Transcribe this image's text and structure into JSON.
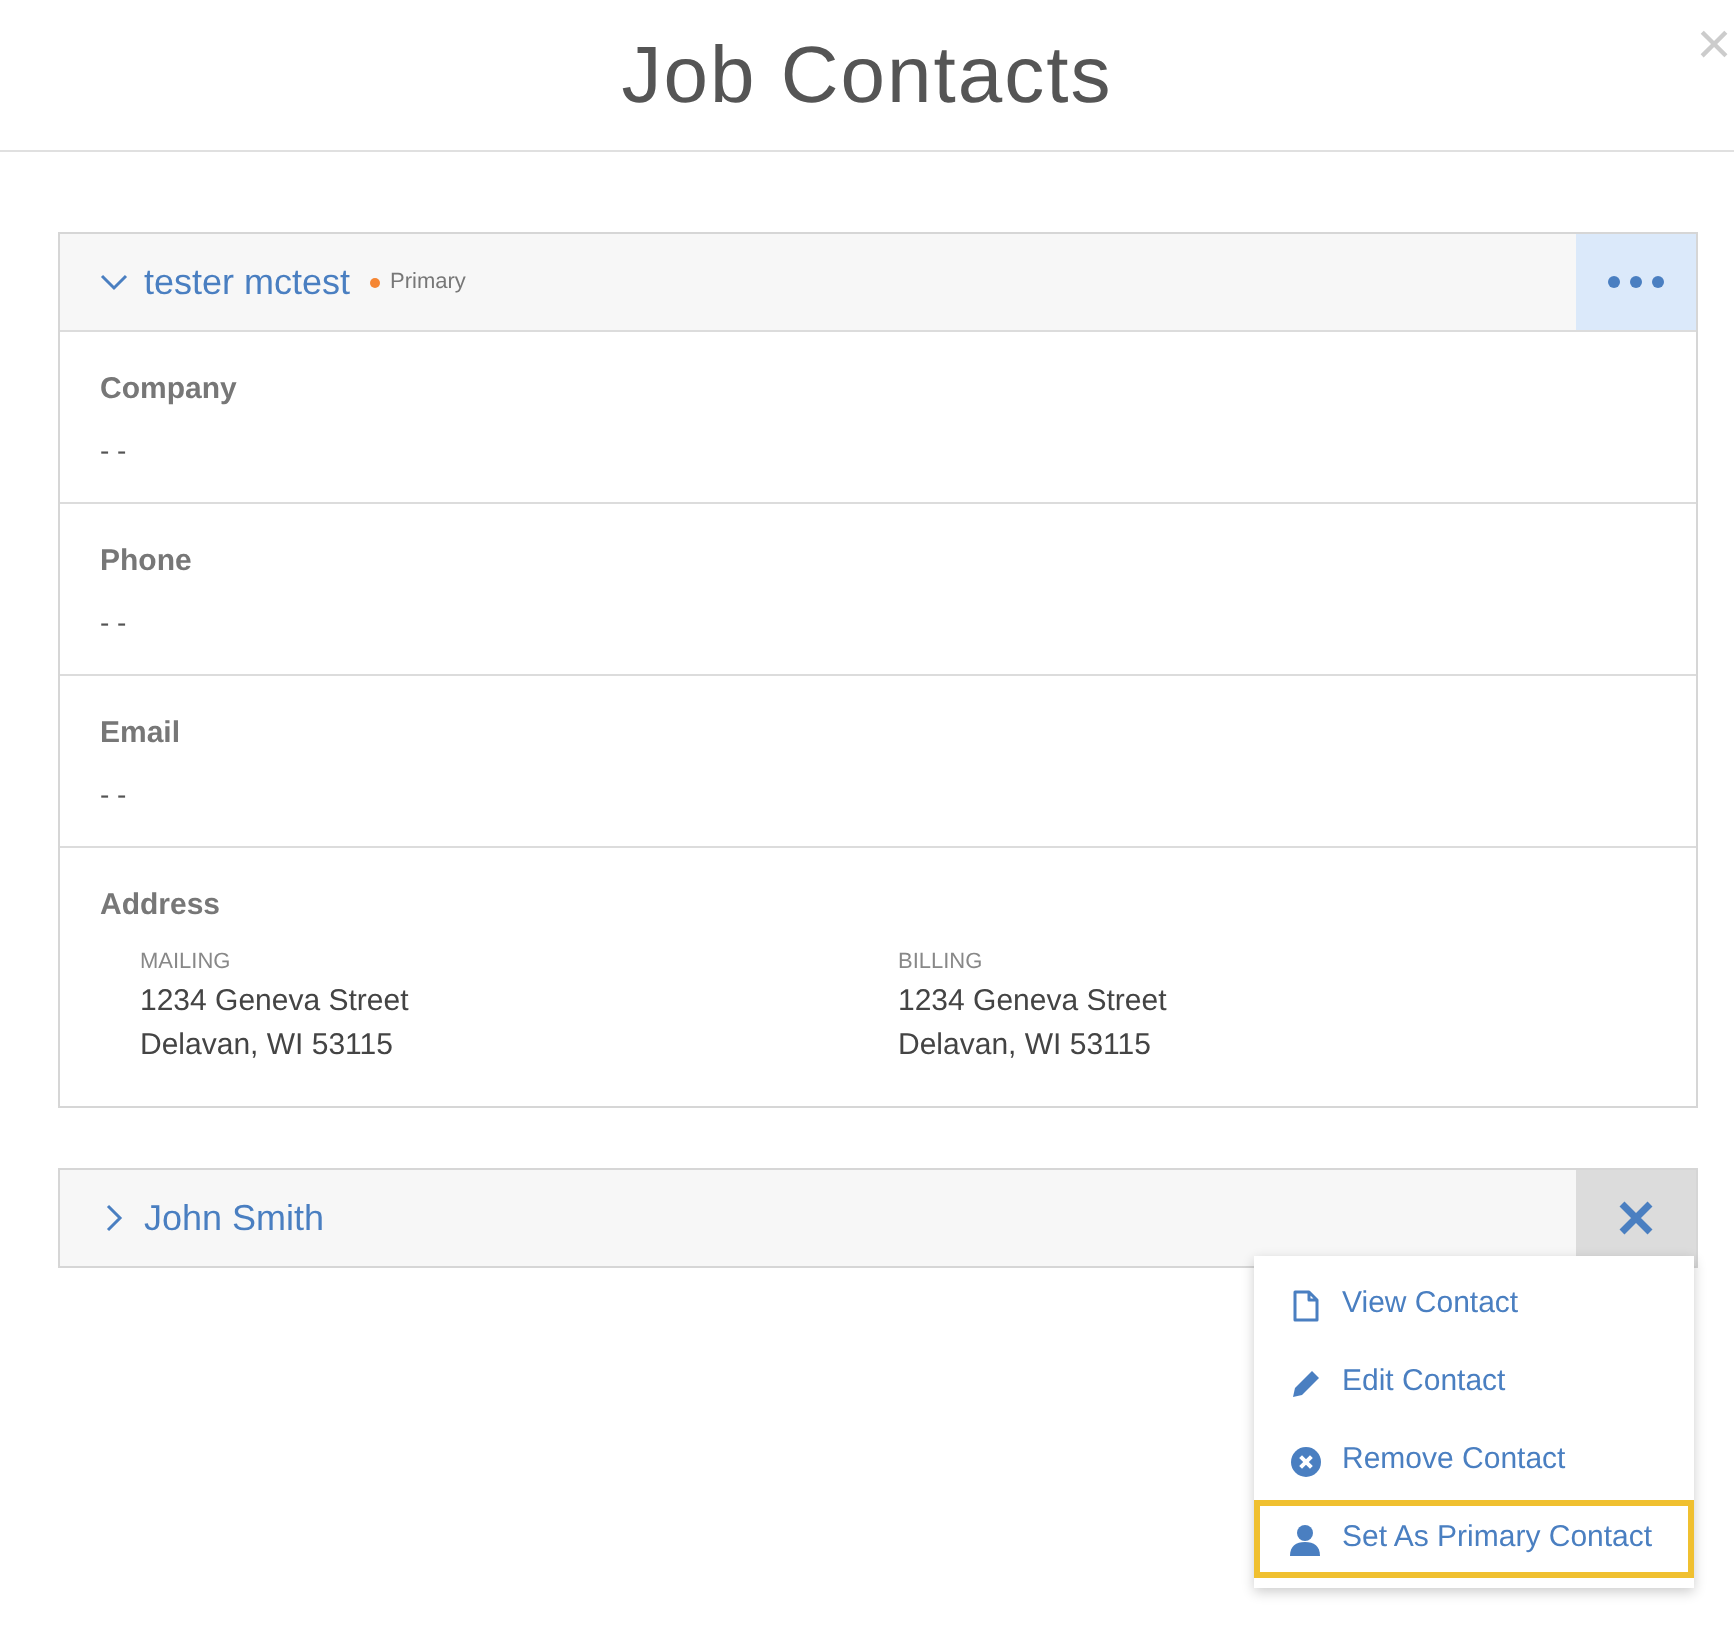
{
  "dialog": {
    "title": "Job Contacts",
    "close": "×"
  },
  "contacts": [
    {
      "name": "tester mctest",
      "expanded": true,
      "badge": "Primary",
      "color": "#f58634",
      "kind": "dots",
      "action_open": false,
      "fields": [
        {
          "label": "Company",
          "value": "- -"
        },
        {
          "label": "Phone",
          "value": "- -"
        },
        {
          "label": "Email",
          "value": "- -"
        }
      ],
      "address": {
        "label": "Address",
        "columns": [
          {
            "heading": "MAILING",
            "lines": [
              "1234 Geneva Street",
              "Delavan, WI 53115"
            ]
          },
          {
            "heading": "BILLING",
            "lines": [
              "1234 Geneva Street",
              "Delavan, WI 53115"
            ]
          }
        ]
      }
    },
    {
      "name": "John Smith",
      "expanded": false,
      "kind": "close",
      "action_open": true
    }
  ],
  "menu": [
    {
      "kind": "file",
      "label": "View Contact",
      "highlighted": false
    },
    {
      "kind": "pencil",
      "label": "Edit Contact",
      "highlighted": false
    },
    {
      "kind": "remove",
      "label": "Remove Contact",
      "highlighted": false
    },
    {
      "kind": "person",
      "label": "Set As Primary Contact",
      "highlighted": true
    }
  ]
}
